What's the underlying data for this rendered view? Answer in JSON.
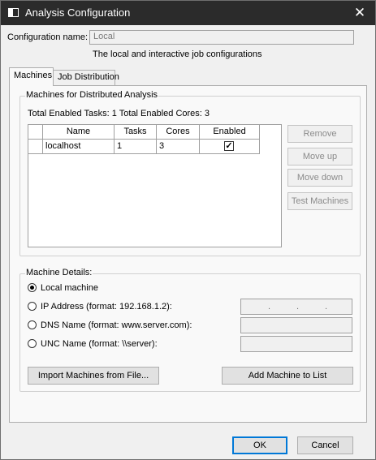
{
  "window": {
    "title": "Analysis Configuration",
    "close_glyph": "✕"
  },
  "config": {
    "name_label": "Configuration name:",
    "name_value": "Local",
    "description": "The local and interactive job configurations"
  },
  "tabs": [
    {
      "label": "Machines",
      "active": true
    },
    {
      "label": "Job Distribution",
      "active": false
    }
  ],
  "machines_group": {
    "title": "Machines for Distributed Analysis",
    "totals": "Total Enabled Tasks: 1  Total Enabled Cores: 3",
    "columns": [
      "Name",
      "Tasks",
      "Cores",
      "Enabled"
    ],
    "rows": [
      {
        "name": "localhost",
        "tasks": "1",
        "cores": "3",
        "enabled": true,
        "check_glyph": "✓"
      }
    ],
    "buttons": {
      "remove": "Remove",
      "move_up": "Move up",
      "move_down": "Move down",
      "test": "Test Machines"
    }
  },
  "details_group": {
    "title": "Machine Details:",
    "options": [
      {
        "label": "Local machine",
        "checked": true
      },
      {
        "label": "IP Address (format: 192.168.1.2):",
        "checked": false
      },
      {
        "label": "DNS Name (format: www.server.com):",
        "checked": false
      },
      {
        "label": "UNC Name (format: \\\\server):",
        "checked": false
      }
    ],
    "ip_separator": ".",
    "import_button": "Import Machines from File...",
    "add_button": "Add Machine to List"
  },
  "footer": {
    "ok": "OK",
    "cancel": "Cancel"
  },
  "colors": {
    "titlebar": "#2b2b2b",
    "focus_border": "#0078d7",
    "panel": "#f9f9f9",
    "dialog": "#f0f0f0"
  },
  "icons": {
    "app": "window-icon",
    "close": "close-icon"
  }
}
